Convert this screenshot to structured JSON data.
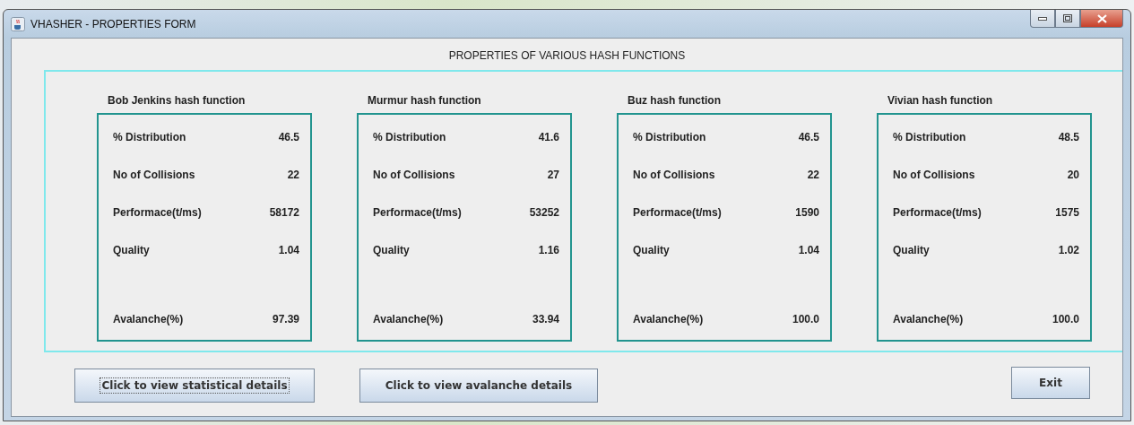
{
  "window": {
    "title": "VHASHER - PROPERTIES FORM"
  },
  "heading": "PROPERTIES OF VARIOUS HASH FUNCTIONS",
  "hash_functions": [
    {
      "name": "Bob Jenkins hash function",
      "rows": [
        {
          "label": "% Distribution",
          "value": "46.5"
        },
        {
          "label": "No of Collisions",
          "value": "22"
        },
        {
          "label": "Performace(t/ms)",
          "value": "58172"
        },
        {
          "label": "Quality",
          "value": "1.04"
        },
        {
          "label": "Avalanche(%)",
          "value": "97.39"
        }
      ]
    },
    {
      "name": "Murmur hash function",
      "rows": [
        {
          "label": "% Distribution",
          "value": "41.6"
        },
        {
          "label": "No of Collisions",
          "value": "27"
        },
        {
          "label": "Performace(t/ms)",
          "value": "53252"
        },
        {
          "label": "Quality",
          "value": "1.16"
        },
        {
          "label": "Avalanche(%)",
          "value": "33.94"
        }
      ]
    },
    {
      "name": "Buz hash function",
      "rows": [
        {
          "label": "% Distribution",
          "value": "46.5"
        },
        {
          "label": "No of Collisions",
          "value": "22"
        },
        {
          "label": "Performace(t/ms)",
          "value": "1590"
        },
        {
          "label": "Quality",
          "value": "1.04"
        },
        {
          "label": "Avalanche(%)",
          "value": "100.0"
        }
      ]
    },
    {
      "name": "Vivian hash function",
      "rows": [
        {
          "label": "% Distribution",
          "value": "48.5"
        },
        {
          "label": "No of Collisions",
          "value": "20"
        },
        {
          "label": "Performace(t/ms)",
          "value": "1575"
        },
        {
          "label": "Quality",
          "value": "1.02"
        },
        {
          "label": "Avalanche(%)",
          "value": "100.0"
        }
      ]
    }
  ],
  "buttons": [
    {
      "label": "Click to view statistical details",
      "focused": true
    },
    {
      "label": "Click to view avalanche details",
      "focused": false
    }
  ],
  "exit_button": {
    "label": "Exit"
  }
}
